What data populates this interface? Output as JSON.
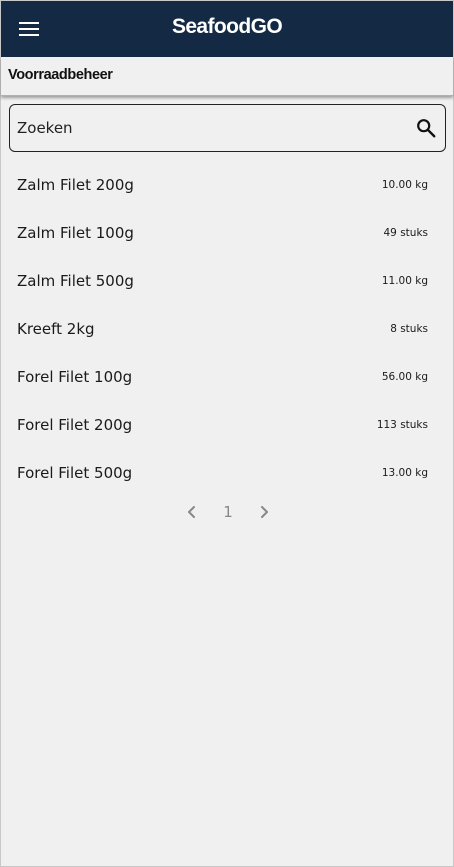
{
  "header": {
    "title": "SeafoodGO",
    "background": "#142a44",
    "menu_icon": "hamburger-menu-icon"
  },
  "subheader": {
    "title": "Voorraadbeheer"
  },
  "search": {
    "placeholder": "Zoeken",
    "icon": "search-icon"
  },
  "products": [
    {
      "name": "Zalm Filet 200g",
      "quantity": "10.00 kg"
    },
    {
      "name": "Zalm Filet 100g",
      "quantity": "49 stuks"
    },
    {
      "name": "Zalm Filet 500g",
      "quantity": "11.00 kg"
    },
    {
      "name": "Kreeft 2kg",
      "quantity": "8 stuks"
    },
    {
      "name": "Forel Filet 100g",
      "quantity": "56.00 kg"
    },
    {
      "name": "Forel Filet 200g",
      "quantity": "113 stuks"
    },
    {
      "name": "Forel Filet 500g",
      "quantity": "13.00 kg"
    }
  ],
  "pagination": {
    "current_page": "1",
    "prev_icon": "chevron-left-icon",
    "next_icon": "chevron-right-icon"
  }
}
